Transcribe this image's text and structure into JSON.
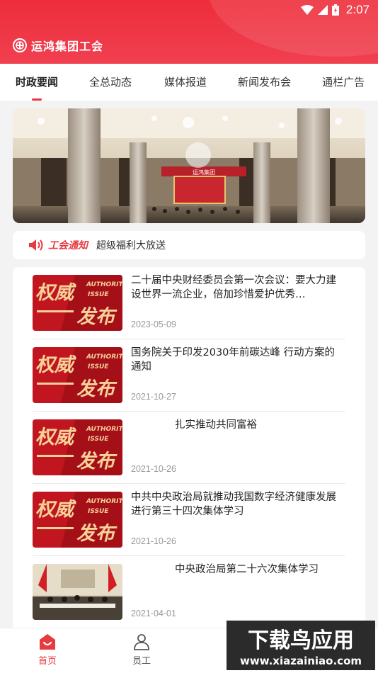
{
  "status_bar": {
    "time": "2:07"
  },
  "header": {
    "title": "运鸿集团工会"
  },
  "tabs": [
    {
      "label": "时政要闻",
      "active": true
    },
    {
      "label": "全总动态",
      "active": false
    },
    {
      "label": "媒体报道",
      "active": false
    },
    {
      "label": "新闻发布会",
      "active": false
    },
    {
      "label": "通栏广告",
      "active": false
    }
  ],
  "banner": {
    "screen_text": "运鸿集团"
  },
  "notice": {
    "tag": "工会通知",
    "message": "超级福利大放送"
  },
  "thumb_text": {
    "big1": "权威",
    "big2": "发布",
    "en1": "AUTHORIT",
    "en2": "ISSUE"
  },
  "news": [
    {
      "title": "二十届中央财经委员会第一次会议：要大力建设世界一流企业，倍加珍惜爱护优秀…",
      "date": "2023-05-09",
      "thumb": "authority"
    },
    {
      "title": "国务院关于印发2030年前碳达峰 行动方案的通知",
      "date": "2021-10-27",
      "thumb": "authority"
    },
    {
      "title": "扎实推动共同富裕",
      "date": "2021-10-26",
      "thumb": "authority"
    },
    {
      "title": "中共中央政治局就推动我国数字经济健康发展进行第三十四次集体学习",
      "date": "2021-10-26",
      "thumb": "authority"
    },
    {
      "title": "中央政治局第二十六次集体学习",
      "date": "2021-04-01",
      "thumb": "meeting"
    }
  ],
  "bottom_nav": [
    {
      "label": "首页",
      "active": true,
      "icon": "home-icon"
    },
    {
      "label": "员工",
      "active": false,
      "icon": "person-icon"
    }
  ],
  "watermark": {
    "line1": "下载鸟应用",
    "line2": "www.xiazainiao.com"
  },
  "colors": {
    "primary": "#e83a3f",
    "header": "#ee2d3b"
  }
}
